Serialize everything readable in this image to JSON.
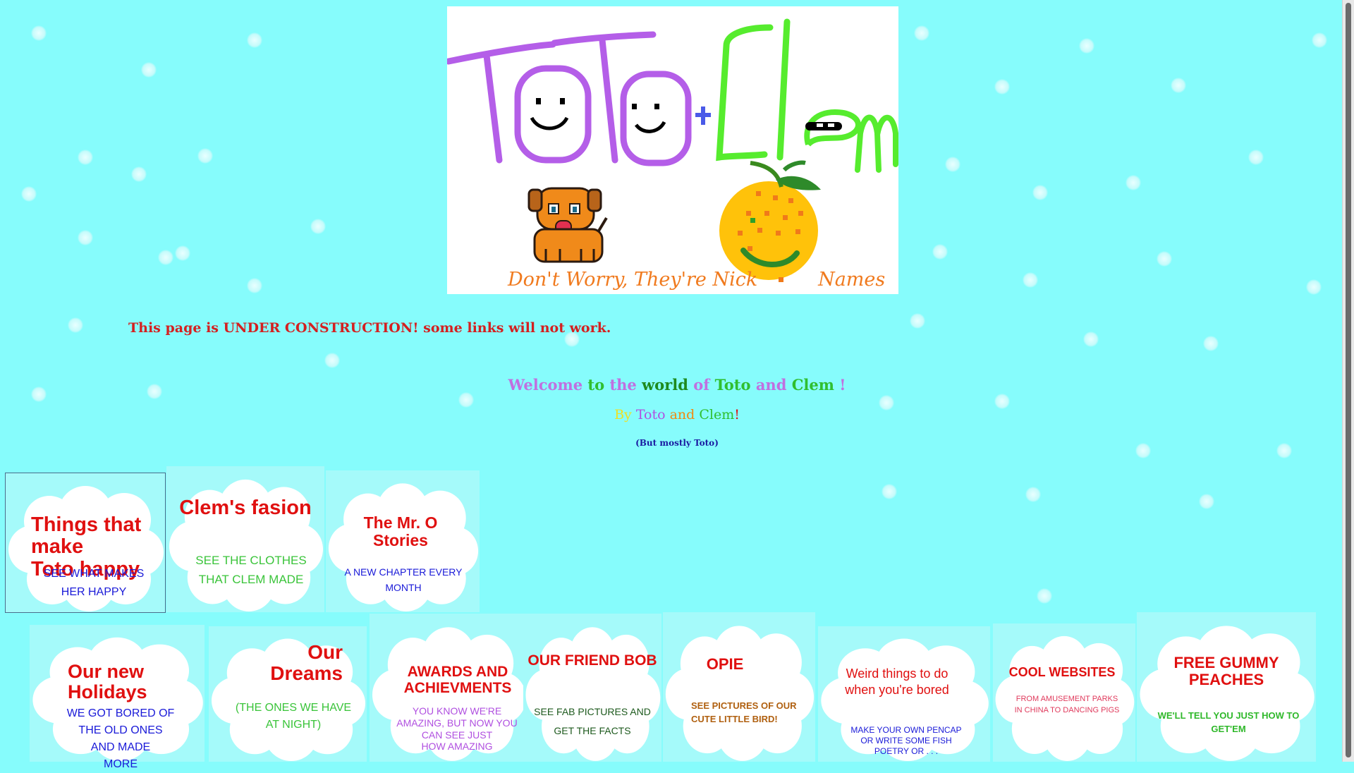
{
  "banner": {
    "logo_alt": "Toto + Clem",
    "caption_left": "Don't Worry, They're Nick",
    "caption_right": "Names"
  },
  "notice": "This page is UNDER CONSTRUCTION! some links will not work.",
  "welcome": {
    "parts": [
      {
        "text": "Welcome ",
        "color": "#c070e0"
      },
      {
        "text": "to ",
        "color": "#2fbf2f"
      },
      {
        "text": "the ",
        "color": "#c070e0"
      },
      {
        "text": "world ",
        "color": "#1e8a1e"
      },
      {
        "text": "of ",
        "color": "#c070e0"
      },
      {
        "text": "Toto ",
        "color": "#2fbf2f"
      },
      {
        "text": "and ",
        "color": "#c070e0"
      },
      {
        "text": "Clem ",
        "color": "#2fbf2f"
      },
      {
        "text": "!",
        "color": "#c070e0"
      }
    ]
  },
  "byline": {
    "parts": [
      {
        "text": "By ",
        "color": "#f0e020"
      },
      {
        "text": "Toto ",
        "color": "#b050e0"
      },
      {
        "text": "and ",
        "color": "#f08a10"
      },
      {
        "text": "Clem",
        "color": "#2fbf2f"
      },
      {
        "text": "!",
        "color": "#e01010"
      }
    ]
  },
  "mostly": "(But mostly Toto)",
  "tiles": [
    {
      "title": "Things that make\nToto happy",
      "sub": "SEE WHAT MAKES\nHER HAPPY"
    },
    {
      "title": "Clem's fasion",
      "sub": "SEE THE CLOTHES\nTHAT CLEM MADE"
    },
    {
      "title": "The Mr. O\nStories",
      "sub": "A NEW CHAPTER EVERY\nMONTH"
    },
    {
      "title": "Our new\nHolidays",
      "sub": "WE GOT BORED OF\nTHE OLD ONES\nAND MADE\nMORE"
    },
    {
      "title": "Our\nDreams",
      "sub": "(THE ONES WE HAVE\nAT NIGHT)"
    },
    {
      "title": "AWARDS AND\nACHIEVMENTS",
      "sub": "YOU KNOW WE'RE\nAMAZING, BUT NOW YOU\nCAN SEE JUST\nHOW AMAZING"
    },
    {
      "title": "OUR FRIEND BOB",
      "sub": "SEE FAB PICTURES AND\nGET THE FACTS"
    },
    {
      "title": "OPIE",
      "sub": "SEE PICTURES OF OUR\nCUTE LITTLE BIRD!"
    },
    {
      "title": "Weird things to do\nwhen you're bored",
      "sub": "MAKE YOUR OWN PENCAP\nOR WRITE SOME FISH\nPOETRY OR . . ."
    },
    {
      "title": "COOL WEBSITES",
      "sub": "FROM AMUSEMENT PARKS\nIN CHINA TO DANCING PIGS"
    },
    {
      "title": "FREE GUMMY PEACHES",
      "sub": "WE'LL TELL YOU JUST HOW TO\nGET'EM"
    }
  ]
}
